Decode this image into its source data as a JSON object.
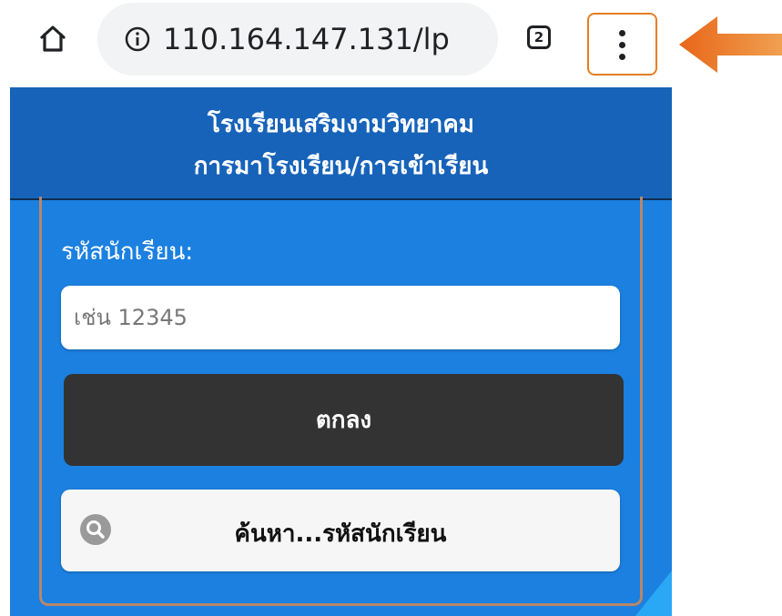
{
  "browser": {
    "url": "110.164.147.131/lp",
    "tab_count": "2"
  },
  "page": {
    "school_name": "โรงเรียนเสริมงามวิทยาคม",
    "subtitle": "การมาโรงเรียน/การเข้าเรียน",
    "student_id_label": "รหัสนักเรียน:",
    "student_id_placeholder": "เช่น 12345",
    "submit_label": "ตกลง",
    "search_label": "ค้นหา...รหัสนักเรียน"
  },
  "icons": {
    "home": "home-icon",
    "info": "info-icon",
    "tabs": "tab-switcher-icon",
    "menu": "kebab-menu-icon",
    "pointer": "arrow-icon",
    "search": "search-icon"
  },
  "colors": {
    "header_bg": "#1763b9",
    "page_bg": "#1b80e0",
    "submit_bg": "#333333",
    "highlight": "#e67e22"
  }
}
